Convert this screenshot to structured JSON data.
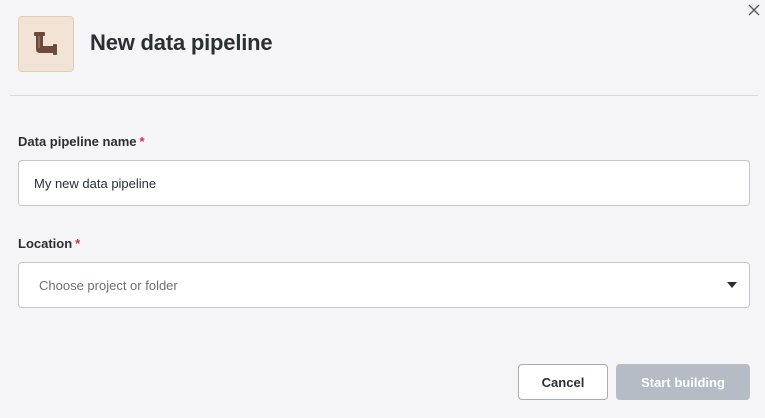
{
  "dialog": {
    "title": "New data pipeline",
    "close_icon": "close-icon",
    "header_icon": "pipe-icon"
  },
  "form": {
    "name_field": {
      "label": "Data pipeline name",
      "required_marker": "*",
      "value": "My new data pipeline"
    },
    "location_field": {
      "label": "Location",
      "required_marker": "*",
      "placeholder": "Choose project or folder",
      "caret_icon": "caret-down-icon"
    }
  },
  "actions": {
    "cancel_label": "Cancel",
    "start_label": "Start building",
    "start_disabled": true
  },
  "colors": {
    "required": "#c8334a",
    "icon_bg": "#f1e3d6",
    "pipe": "#6e4a3a",
    "disabled_button": "#b6bcc6"
  }
}
